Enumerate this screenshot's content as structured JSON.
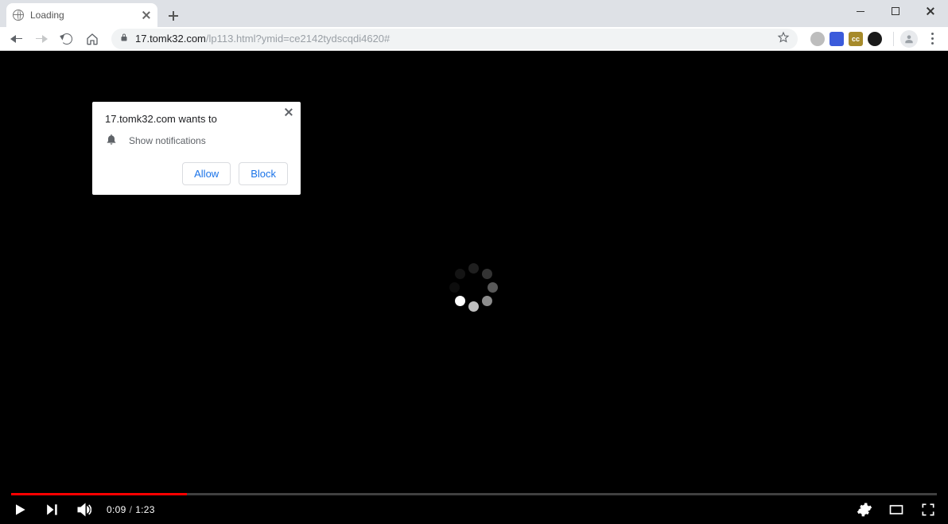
{
  "window": {
    "minimize_name": "minimize",
    "maximize_name": "maximize",
    "close_name": "close"
  },
  "tab": {
    "title": "Loading"
  },
  "toolbar": {
    "url_host": "17.tomk32.com",
    "url_path": "/lp113.html?ymid=ce2142tydscqdi4620#"
  },
  "ext_icons": [
    {
      "bg": "#bdbdbd",
      "shape": "circle",
      "txt": ""
    },
    {
      "bg": "#3b5bdb",
      "shape": "square",
      "txt": ""
    },
    {
      "bg": "#a68a2a",
      "shape": "square",
      "txt": "cc"
    },
    {
      "bg": "#1a1a1a",
      "shape": "circle",
      "txt": ""
    }
  ],
  "perm": {
    "title": "17.tomk32.com wants to",
    "line": "Show notifications",
    "allow": "Allow",
    "block": "Block"
  },
  "video": {
    "current": "0:09",
    "duration": "1:23",
    "played_ratio": 0.19
  },
  "spinner_dots": [
    {
      "angle": 0,
      "opacity": 0.12
    },
    {
      "angle": 45,
      "opacity": 0.2
    },
    {
      "angle": 90,
      "opacity": 0.35
    },
    {
      "angle": 135,
      "opacity": 0.55
    },
    {
      "angle": 180,
      "opacity": 0.75
    },
    {
      "angle": 225,
      "opacity": 1.0
    },
    {
      "angle": 270,
      "opacity": 0.05
    },
    {
      "angle": 315,
      "opacity": 0.08
    }
  ]
}
